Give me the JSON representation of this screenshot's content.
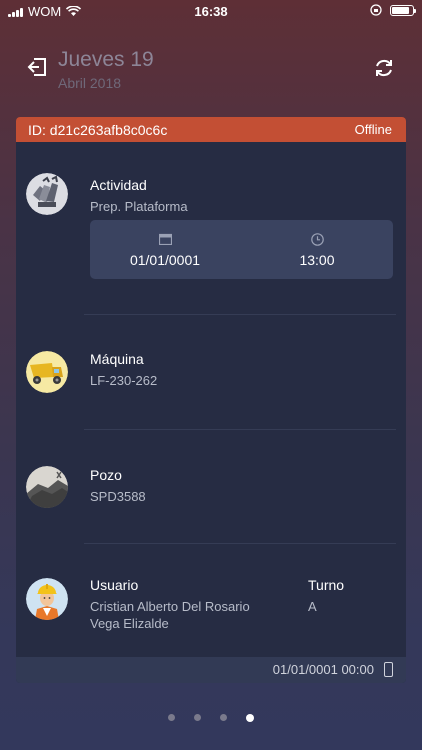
{
  "status_bar": {
    "carrier": "WOM",
    "time": "16:38",
    "battery_level": 0.85
  },
  "header": {
    "day": "Jueves 19",
    "month": "Abril 2018"
  },
  "card": {
    "id_text": "ID: d21c263afb8c0c6c",
    "status": "Offline",
    "actividad": {
      "title": "Actividad",
      "value": "Prep. Plataforma",
      "date": "01/01/0001",
      "time": "13:00"
    },
    "maquina": {
      "title": "Máquina",
      "value": "LF-230-262"
    },
    "pozo": {
      "title": "Pozo",
      "value": "SPD3588"
    },
    "usuario": {
      "title": "Usuario",
      "name_line1": "Cristian Alberto Del Rosario",
      "name_line2": "Vega Elizalde"
    },
    "turno": {
      "title": "Turno",
      "value": "A"
    },
    "footer": "01/01/0001 00:00"
  },
  "pagination": {
    "total": 4,
    "active_index": 3
  },
  "icons": {
    "back": "exit-icon",
    "refresh": "refresh-icon",
    "calendar": "calendar-icon",
    "clock": "clock-icon",
    "phone": "phone-icon"
  }
}
